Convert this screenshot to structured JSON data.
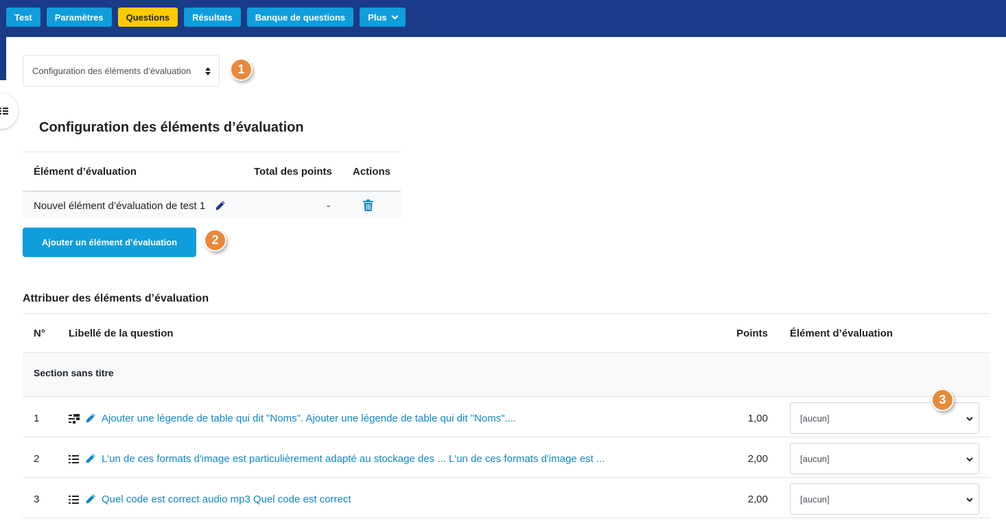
{
  "nav": {
    "tabs": [
      {
        "label": "Test",
        "active": false
      },
      {
        "label": "Paramètres",
        "active": false
      },
      {
        "label": "Questions",
        "active": true
      },
      {
        "label": "Résultats",
        "active": false
      },
      {
        "label": "Banque de questions",
        "active": false
      },
      {
        "label": "Plus",
        "active": false
      }
    ]
  },
  "view_select": {
    "value": "Configuration des éléments d’évaluation"
  },
  "callouts": [
    "1",
    "2",
    "3"
  ],
  "config": {
    "title": "Configuration des éléments d’évaluation",
    "headers": {
      "element": "Élément d’évaluation",
      "total": "Total des points",
      "actions": "Actions"
    },
    "rows": [
      {
        "name": "Nouvel élément d’évaluation de test 1",
        "total": "-"
      }
    ],
    "add_button": "Ajouter un élément d’évaluation"
  },
  "assign": {
    "title": "Attribuer des éléments d’évaluation",
    "headers": {
      "num": "N°",
      "label": "Libellé de la question",
      "points": "Points",
      "element": "Élément d’évaluation"
    },
    "section": "Section sans titre",
    "questions": [
      {
        "num": "1",
        "label": "Ajouter une légende de table qui dit \"Noms\". Ajouter une légende de table qui dit \"Noms\"....",
        "points": "1,00",
        "element": "[aucun]",
        "type_icon": "ddwtos-icon"
      },
      {
        "num": "2",
        "label": "L'un de ces formats d'image est particulièrement adapté au stockage des ... L'un de ces formats d'image est ...",
        "points": "2,00",
        "element": "[aucun]",
        "type_icon": "multichoice-icon"
      },
      {
        "num": "3",
        "label": "Quel code est correct audio mp3 Quel code est correct",
        "points": "2,00",
        "element": "[aucun]",
        "type_icon": "multichoice-icon"
      }
    ]
  },
  "colors": {
    "navbar": "#1b3a87",
    "button": "#0f9ddb",
    "active_tab": "#ffcc00",
    "link": "#0f86c4",
    "callout": "#e8893c"
  }
}
